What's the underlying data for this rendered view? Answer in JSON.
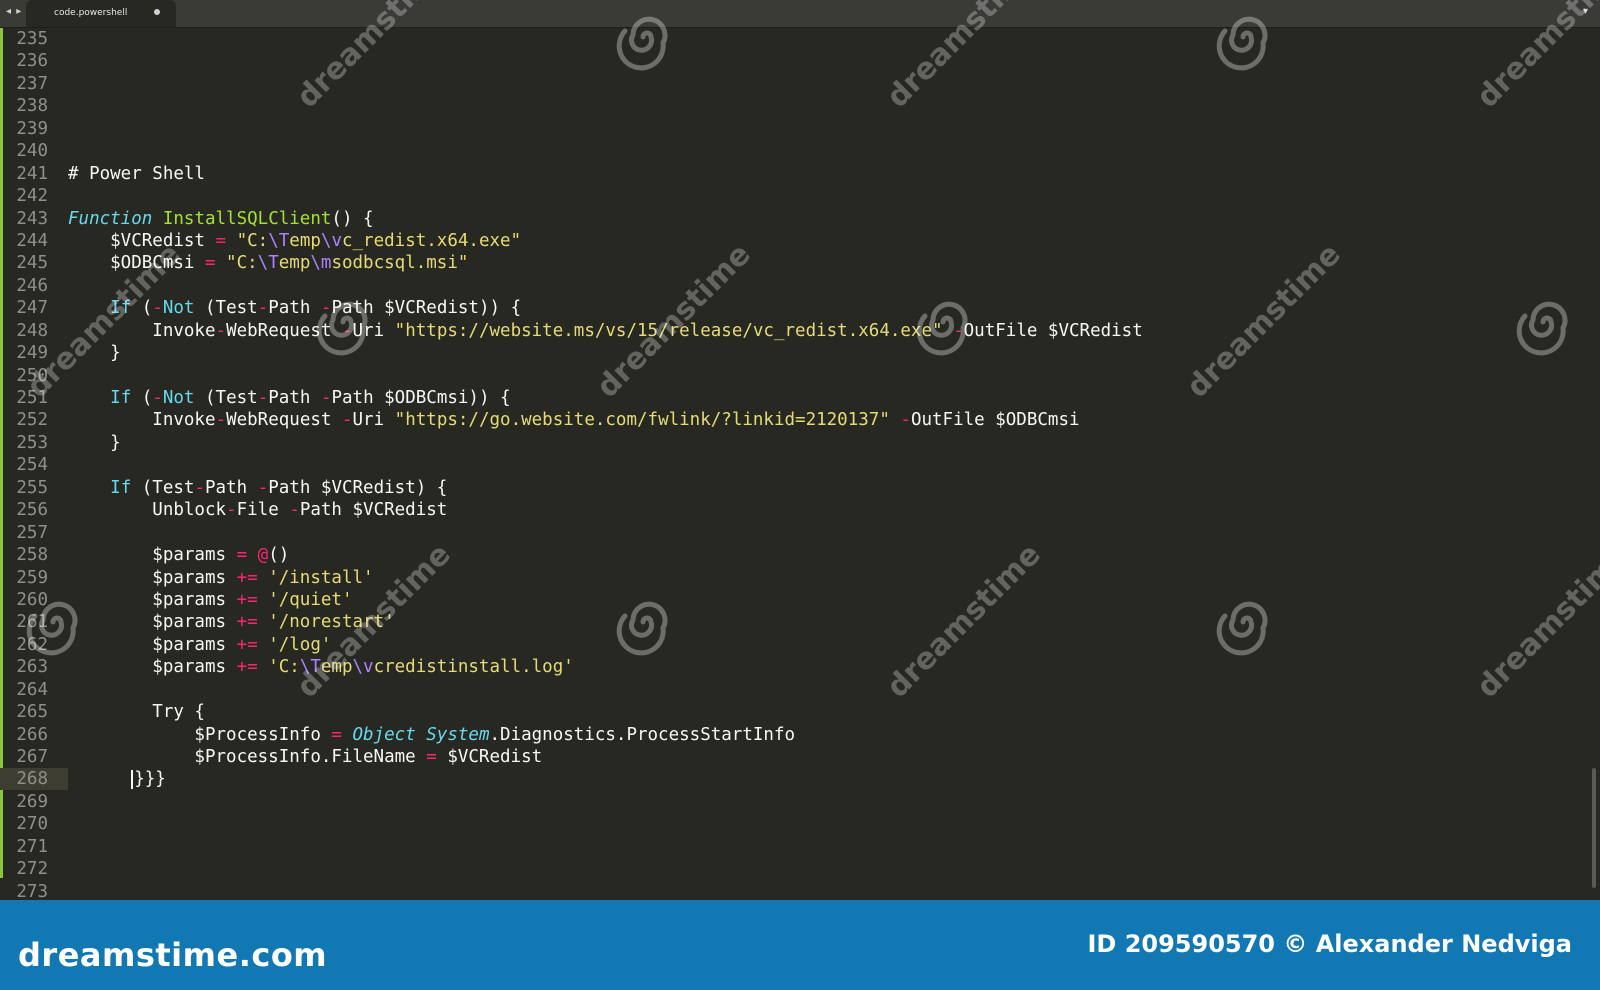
{
  "tab": {
    "nav_arrows": "◂ ▸",
    "title": "code.powershell",
    "dropdown": "▾"
  },
  "editor": {
    "current_line": "268",
    "lines": [
      {
        "n": "235",
        "tokens": []
      },
      {
        "n": "236",
        "tokens": []
      },
      {
        "n": "237",
        "tokens": []
      },
      {
        "n": "238",
        "tokens": []
      },
      {
        "n": "239",
        "tokens": []
      },
      {
        "n": "240",
        "tokens": []
      },
      {
        "n": "241",
        "tokens": [
          {
            "t": "# Power Shell",
            "c": "com"
          }
        ]
      },
      {
        "n": "242",
        "tokens": []
      },
      {
        "n": "243",
        "tokens": [
          {
            "t": "Function",
            "c": "kwi"
          },
          {
            "t": " ",
            "c": ""
          },
          {
            "t": "InstallSQLClient",
            "c": "fn"
          },
          {
            "t": "() {",
            "c": ""
          }
        ]
      },
      {
        "n": "244",
        "tokens": [
          {
            "t": "    $VCRedist ",
            "c": ""
          },
          {
            "t": "=",
            "c": "op"
          },
          {
            "t": " \"C:",
            "c": "str"
          },
          {
            "t": "\\T",
            "c": "esc"
          },
          {
            "t": "emp",
            "c": "str"
          },
          {
            "t": "\\v",
            "c": "esc"
          },
          {
            "t": "c_redist.x64.exe\"",
            "c": "str"
          }
        ]
      },
      {
        "n": "245",
        "tokens": [
          {
            "t": "    $ODBCmsi ",
            "c": ""
          },
          {
            "t": "=",
            "c": "op"
          },
          {
            "t": " \"C:",
            "c": "str"
          },
          {
            "t": "\\T",
            "c": "esc"
          },
          {
            "t": "emp",
            "c": "str"
          },
          {
            "t": "\\m",
            "c": "esc"
          },
          {
            "t": "sodbcsql.msi\"",
            "c": "str"
          }
        ]
      },
      {
        "n": "246",
        "tokens": []
      },
      {
        "n": "247",
        "tokens": [
          {
            "t": "    ",
            "c": ""
          },
          {
            "t": "If",
            "c": "kw"
          },
          {
            "t": " (",
            "c": ""
          },
          {
            "t": "-",
            "c": "op"
          },
          {
            "t": "Not",
            "c": "kw"
          },
          {
            "t": " (Test",
            "c": ""
          },
          {
            "t": "-",
            "c": "op"
          },
          {
            "t": "Path ",
            "c": ""
          },
          {
            "t": "-",
            "c": "op"
          },
          {
            "t": "Path $VCRedist)) {",
            "c": ""
          }
        ]
      },
      {
        "n": "248",
        "tokens": [
          {
            "t": "        Invoke",
            "c": ""
          },
          {
            "t": "-",
            "c": "op"
          },
          {
            "t": "WebRequest ",
            "c": ""
          },
          {
            "t": "-",
            "c": "op"
          },
          {
            "t": "Uri ",
            "c": ""
          },
          {
            "t": "\"https://website.ms/vs/15/release/vc_redist.x64.exe\"",
            "c": "str"
          },
          {
            "t": " ",
            "c": ""
          },
          {
            "t": "-",
            "c": "op"
          },
          {
            "t": "OutFile $VCRedist",
            "c": ""
          }
        ]
      },
      {
        "n": "249",
        "tokens": [
          {
            "t": "    }",
            "c": ""
          }
        ]
      },
      {
        "n": "250",
        "tokens": []
      },
      {
        "n": "251",
        "tokens": [
          {
            "t": "    ",
            "c": ""
          },
          {
            "t": "If",
            "c": "kw"
          },
          {
            "t": " (",
            "c": ""
          },
          {
            "t": "-",
            "c": "op"
          },
          {
            "t": "Not",
            "c": "kw"
          },
          {
            "t": " (Test",
            "c": ""
          },
          {
            "t": "-",
            "c": "op"
          },
          {
            "t": "Path ",
            "c": ""
          },
          {
            "t": "-",
            "c": "op"
          },
          {
            "t": "Path $ODBCmsi)) {",
            "c": ""
          }
        ]
      },
      {
        "n": "252",
        "tokens": [
          {
            "t": "        Invoke",
            "c": ""
          },
          {
            "t": "-",
            "c": "op"
          },
          {
            "t": "WebRequest ",
            "c": ""
          },
          {
            "t": "-",
            "c": "op"
          },
          {
            "t": "Uri ",
            "c": ""
          },
          {
            "t": "\"https://go.website.com/fwlink/?linkid=2120137\"",
            "c": "str"
          },
          {
            "t": " ",
            "c": ""
          },
          {
            "t": "-",
            "c": "op"
          },
          {
            "t": "OutFile $ODBCmsi",
            "c": ""
          }
        ]
      },
      {
        "n": "253",
        "tokens": [
          {
            "t": "    }",
            "c": ""
          }
        ]
      },
      {
        "n": "254",
        "tokens": []
      },
      {
        "n": "255",
        "tokens": [
          {
            "t": "    ",
            "c": ""
          },
          {
            "t": "If",
            "c": "kw"
          },
          {
            "t": " (Test",
            "c": ""
          },
          {
            "t": "-",
            "c": "op"
          },
          {
            "t": "Path ",
            "c": ""
          },
          {
            "t": "-",
            "c": "op"
          },
          {
            "t": "Path $VCRedist) {",
            "c": ""
          }
        ]
      },
      {
        "n": "256",
        "tokens": [
          {
            "t": "        Unblock",
            "c": ""
          },
          {
            "t": "-",
            "c": "op"
          },
          {
            "t": "File ",
            "c": ""
          },
          {
            "t": "-",
            "c": "op"
          },
          {
            "t": "Path $VCRedist",
            "c": ""
          }
        ]
      },
      {
        "n": "257",
        "tokens": []
      },
      {
        "n": "258",
        "tokens": [
          {
            "t": "        $params ",
            "c": ""
          },
          {
            "t": "=",
            "c": "op"
          },
          {
            "t": " ",
            "c": ""
          },
          {
            "t": "@",
            "c": "op"
          },
          {
            "t": "()",
            "c": ""
          }
        ]
      },
      {
        "n": "259",
        "tokens": [
          {
            "t": "        $params ",
            "c": ""
          },
          {
            "t": "+=",
            "c": "op"
          },
          {
            "t": " ",
            "c": ""
          },
          {
            "t": "'/install'",
            "c": "str"
          }
        ]
      },
      {
        "n": "260",
        "tokens": [
          {
            "t": "        $params ",
            "c": ""
          },
          {
            "t": "+=",
            "c": "op"
          },
          {
            "t": " ",
            "c": ""
          },
          {
            "t": "'/quiet'",
            "c": "str"
          }
        ]
      },
      {
        "n": "261",
        "tokens": [
          {
            "t": "        $params ",
            "c": ""
          },
          {
            "t": "+=",
            "c": "op"
          },
          {
            "t": " ",
            "c": ""
          },
          {
            "t": "'/norestart'",
            "c": "str"
          }
        ]
      },
      {
        "n": "262",
        "tokens": [
          {
            "t": "        $params ",
            "c": ""
          },
          {
            "t": "+=",
            "c": "op"
          },
          {
            "t": " ",
            "c": ""
          },
          {
            "t": "'/log'",
            "c": "str"
          }
        ]
      },
      {
        "n": "263",
        "tokens": [
          {
            "t": "        $params ",
            "c": ""
          },
          {
            "t": "+=",
            "c": "op"
          },
          {
            "t": " ",
            "c": ""
          },
          {
            "t": "'C:",
            "c": "str"
          },
          {
            "t": "\\T",
            "c": "esc"
          },
          {
            "t": "emp",
            "c": "str"
          },
          {
            "t": "\\v",
            "c": "esc"
          },
          {
            "t": "credistinstall.log'",
            "c": "str"
          }
        ]
      },
      {
        "n": "264",
        "tokens": []
      },
      {
        "n": "265",
        "tokens": [
          {
            "t": "        Try {",
            "c": ""
          }
        ]
      },
      {
        "n": "266",
        "tokens": [
          {
            "t": "            $ProcessInfo ",
            "c": ""
          },
          {
            "t": "=",
            "c": "op"
          },
          {
            "t": " ",
            "c": ""
          },
          {
            "t": "Object",
            "c": "kwi"
          },
          {
            "t": " ",
            "c": ""
          },
          {
            "t": "System",
            "c": "kwi"
          },
          {
            "t": ".Diagnostics.ProcessStartInfo",
            "c": ""
          }
        ]
      },
      {
        "n": "267",
        "tokens": [
          {
            "t": "            $ProcessInfo.FileName ",
            "c": ""
          },
          {
            "t": "=",
            "c": "op"
          },
          {
            "t": " $VCRedist",
            "c": ""
          }
        ]
      },
      {
        "n": "268",
        "tokens": [
          {
            "t": "      ",
            "c": ""
          },
          {
            "t": "|",
            "c": "cursor"
          },
          {
            "t": "}}}",
            "c": ""
          }
        ]
      },
      {
        "n": "269",
        "tokens": []
      },
      {
        "n": "270",
        "tokens": []
      },
      {
        "n": "271",
        "tokens": []
      },
      {
        "n": "272",
        "tokens": []
      },
      {
        "n": "273",
        "tokens": []
      }
    ]
  },
  "watermark": {
    "text": "dreamstime",
    "footer_logo": "dreamstime.com",
    "credit": "ID 209590570 © Alexander Nedviga"
  },
  "colors": {
    "background": "#272822",
    "keyword": "#66d9ef",
    "function": "#a6e22e",
    "string": "#e6db74",
    "escape": "#ae81ff",
    "operator": "#f92672",
    "footer": "#1178b3"
  }
}
